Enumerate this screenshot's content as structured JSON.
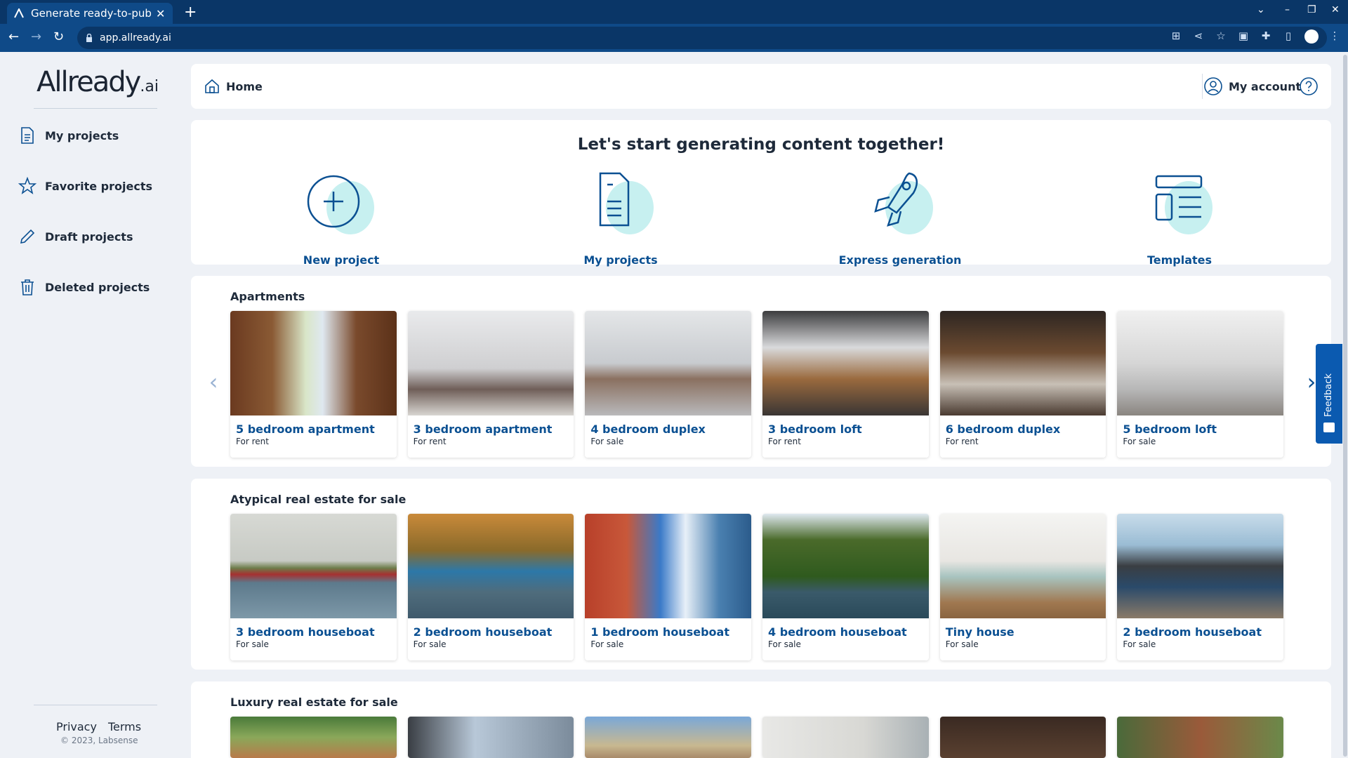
{
  "browser": {
    "tab_title": "Generate ready-to-publish",
    "tab_close": "✕",
    "new_tab": "+",
    "url": "app.allready.ai"
  },
  "sidebar": {
    "logo_main": "Allready",
    "logo_suffix": ".ai",
    "items": [
      {
        "label": "My projects",
        "icon": "document-icon"
      },
      {
        "label": "Favorite projects",
        "icon": "star-icon"
      },
      {
        "label": "Draft projects",
        "icon": "pencil-icon"
      },
      {
        "label": "Deleted projects",
        "icon": "trash-icon"
      }
    ],
    "footer": {
      "privacy": "Privacy",
      "terms": "Terms",
      "copyright": "© 2023, Labsense"
    }
  },
  "topbar": {
    "home": "Home",
    "account": "My account"
  },
  "hero": {
    "title": "Let's start generating content together!",
    "actions": [
      {
        "label": "New project",
        "icon": "plus-circle-icon"
      },
      {
        "label": "My projects",
        "icon": "document-icon"
      },
      {
        "label": "Express generation",
        "icon": "rocket-icon"
      },
      {
        "label": "Templates",
        "icon": "templates-icon"
      }
    ]
  },
  "sections": [
    {
      "title": "Apartments",
      "cards": [
        {
          "title": "5 bedroom apartment",
          "sub": "For rent"
        },
        {
          "title": "3 bedroom apartment",
          "sub": "For rent"
        },
        {
          "title": "4 bedroom duplex",
          "sub": "For sale"
        },
        {
          "title": "3 bedroom loft",
          "sub": "For rent"
        },
        {
          "title": "6 bedroom duplex",
          "sub": "For rent"
        },
        {
          "title": "5 bedroom loft",
          "sub": "For sale"
        }
      ]
    },
    {
      "title": "Atypical real estate for sale",
      "cards": [
        {
          "title": "3 bedroom houseboat",
          "sub": "For sale"
        },
        {
          "title": "2 bedroom houseboat",
          "sub": "For sale"
        },
        {
          "title": "1 bedroom houseboat",
          "sub": "For sale"
        },
        {
          "title": "4 bedroom houseboat",
          "sub": "For sale"
        },
        {
          "title": "Tiny house",
          "sub": "For sale"
        },
        {
          "title": "2 bedroom houseboat",
          "sub": "For sale"
        }
      ]
    },
    {
      "title": "Luxury real estate for sale",
      "cards": []
    }
  ],
  "feedback": "Feedback",
  "colors": {
    "brand": "#0b5092",
    "chrome": "#0a3667",
    "accent_blob": "#c7f0f0"
  }
}
